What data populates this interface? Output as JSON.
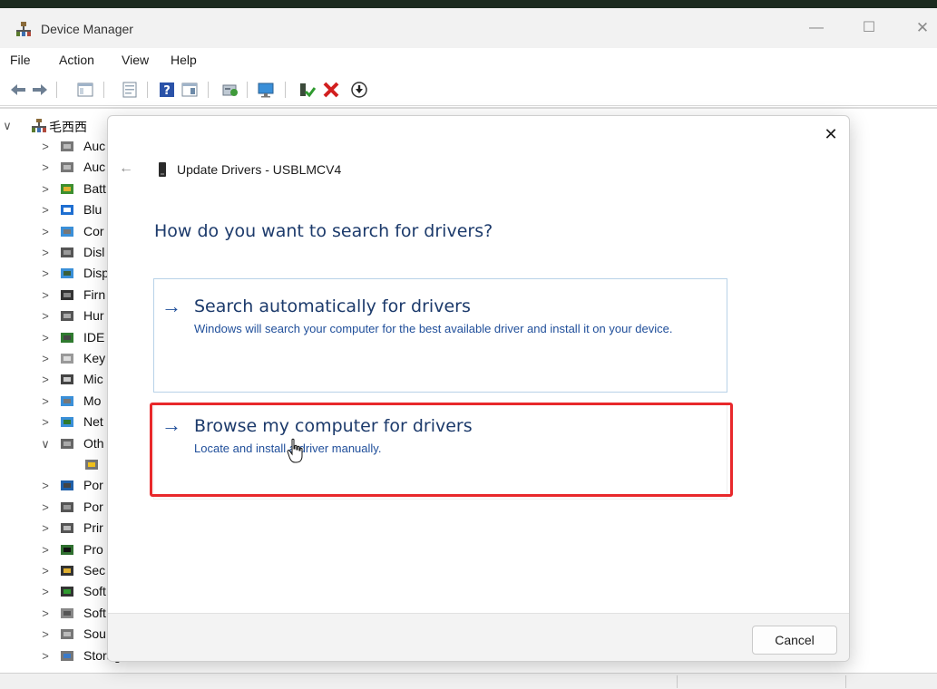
{
  "window": {
    "title": "Device Manager",
    "controls": {
      "minimize": "—",
      "maximize": "☐",
      "close": "✕"
    }
  },
  "menu": {
    "items": [
      "File",
      "Action",
      "View",
      "Help"
    ]
  },
  "toolbar": {
    "buttons": [
      "back-icon",
      "forward-icon",
      "show-hide-console-tree-icon",
      "properties-icon",
      "help-icon",
      "view-icon",
      "scan-hardware-icon",
      "display-icon",
      "enable-device-icon",
      "uninstall-device-icon",
      "disable-device-icon"
    ]
  },
  "tree": {
    "root": {
      "chevron": "∨",
      "label": "毛西西"
    },
    "items": [
      {
        "chevron": ">",
        "label": "Auc",
        "icon": "audio-icon"
      },
      {
        "chevron": ">",
        "label": "Auc",
        "icon": "audio-icon"
      },
      {
        "chevron": ">",
        "label": "Batt",
        "icon": "battery-icon"
      },
      {
        "chevron": ">",
        "label": "Blu",
        "icon": "bluetooth-icon"
      },
      {
        "chevron": ">",
        "label": "Cor",
        "icon": "computer-icon"
      },
      {
        "chevron": ">",
        "label": "Disl",
        "icon": "disk-icon"
      },
      {
        "chevron": ">",
        "label": "Disp",
        "icon": "display-adapter-icon"
      },
      {
        "chevron": ">",
        "label": "Firn",
        "icon": "firmware-icon"
      },
      {
        "chevron": ">",
        "label": "Hur",
        "icon": "hid-icon"
      },
      {
        "chevron": ">",
        "label": "IDE",
        "icon": "ide-icon"
      },
      {
        "chevron": ">",
        "label": "Key",
        "icon": "keyboard-icon"
      },
      {
        "chevron": ">",
        "label": "Mic",
        "icon": "mouse-icon"
      },
      {
        "chevron": ">",
        "label": "Mo",
        "icon": "monitor-icon"
      },
      {
        "chevron": ">",
        "label": "Net",
        "icon": "network-icon"
      },
      {
        "chevron": "∨",
        "label": "Oth",
        "icon": "other-devices-icon"
      },
      {
        "chevron": "",
        "label": "",
        "icon": "unknown-device-warning-icon"
      },
      {
        "chevron": ">",
        "label": "Por",
        "icon": "portable-device-icon"
      },
      {
        "chevron": ">",
        "label": "Por",
        "icon": "ports-icon"
      },
      {
        "chevron": ">",
        "label": "Prir",
        "icon": "printer-icon"
      },
      {
        "chevron": ">",
        "label": "Pro",
        "icon": "processor-icon"
      },
      {
        "chevron": ">",
        "label": "Sec",
        "icon": "security-icon"
      },
      {
        "chevron": ">",
        "label": "Soft",
        "icon": "software-component-icon"
      },
      {
        "chevron": ">",
        "label": "Soft",
        "icon": "software-device-icon"
      },
      {
        "chevron": ">",
        "label": "Sou",
        "icon": "sound-icon"
      },
      {
        "chevron": ">",
        "label": "Storage controllers",
        "icon": "storage-icon"
      }
    ]
  },
  "dialog": {
    "close": "✕",
    "back": "←",
    "title": "Update Drivers - USBLMCV4",
    "heading": "How do you want to search for drivers?",
    "options": [
      {
        "arrow": "→",
        "title": "Search automatically for drivers",
        "description": "Windows will search your computer for the best available driver and install it on your device."
      },
      {
        "arrow": "→",
        "title": "Browse my computer for drivers",
        "description": "Locate and install a driver manually."
      }
    ],
    "cancel_label": "Cancel"
  },
  "colors": {
    "accent_link": "#1f4e9a",
    "heading": "#1c3a6b",
    "highlight_box": "#e8282b"
  }
}
